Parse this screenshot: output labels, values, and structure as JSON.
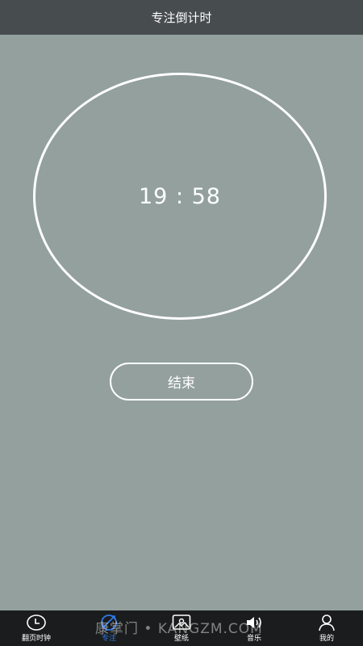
{
  "header": {
    "title": "专注倒计时"
  },
  "timer": {
    "display": "19 : 58"
  },
  "actions": {
    "end_label": "结束"
  },
  "tabs": [
    {
      "label": "翻页时钟",
      "icon": "clock-icon"
    },
    {
      "label": "专注",
      "icon": "focus-icon",
      "active": true
    },
    {
      "label": "壁纸",
      "icon": "image-icon"
    },
    {
      "label": "音乐",
      "icon": "speaker-icon"
    },
    {
      "label": "我的",
      "icon": "person-icon"
    }
  ],
  "watermark": {
    "text": "康掌门 • KANGZM.COM"
  },
  "colors": {
    "background": "#93a09e",
    "header": "#474c4e",
    "tabbar": "#1b1c1d",
    "active_tab": "#2f7ae8"
  }
}
